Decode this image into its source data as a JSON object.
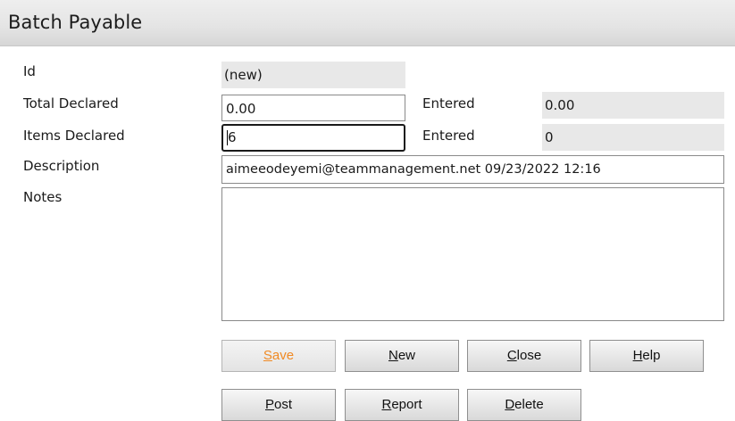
{
  "window": {
    "title": "Batch Payable"
  },
  "form": {
    "id_label": "Id",
    "id_value": "(new)",
    "total_declared_label": "Total Declared",
    "total_declared_value": "0.00",
    "total_entered_label": "Entered",
    "total_entered_value": "0.00",
    "items_declared_label": "Items Declared",
    "items_declared_value": "6",
    "items_entered_label": "Entered",
    "items_entered_value": "0",
    "description_label": "Description",
    "description_value": "aimeeodeyemi@teammanagement.net 09/23/2022 12:16",
    "notes_label": "Notes",
    "notes_value": ""
  },
  "buttons": {
    "save": {
      "accel": "S",
      "rest": "ave"
    },
    "new": {
      "accel": "N",
      "rest": "ew"
    },
    "close": {
      "accel": "C",
      "rest": "lose"
    },
    "help": {
      "accel": "H",
      "rest": "elp"
    },
    "post": {
      "accel": "P",
      "rest": "ost"
    },
    "report": {
      "accel": "R",
      "rest": "eport"
    },
    "delete": {
      "accel": "D",
      "rest": "elete"
    }
  },
  "colors": {
    "save_label": "#f08a24",
    "readonly_bg": "#e8e8e8",
    "title_bar_bg": "#e4e4e4"
  }
}
